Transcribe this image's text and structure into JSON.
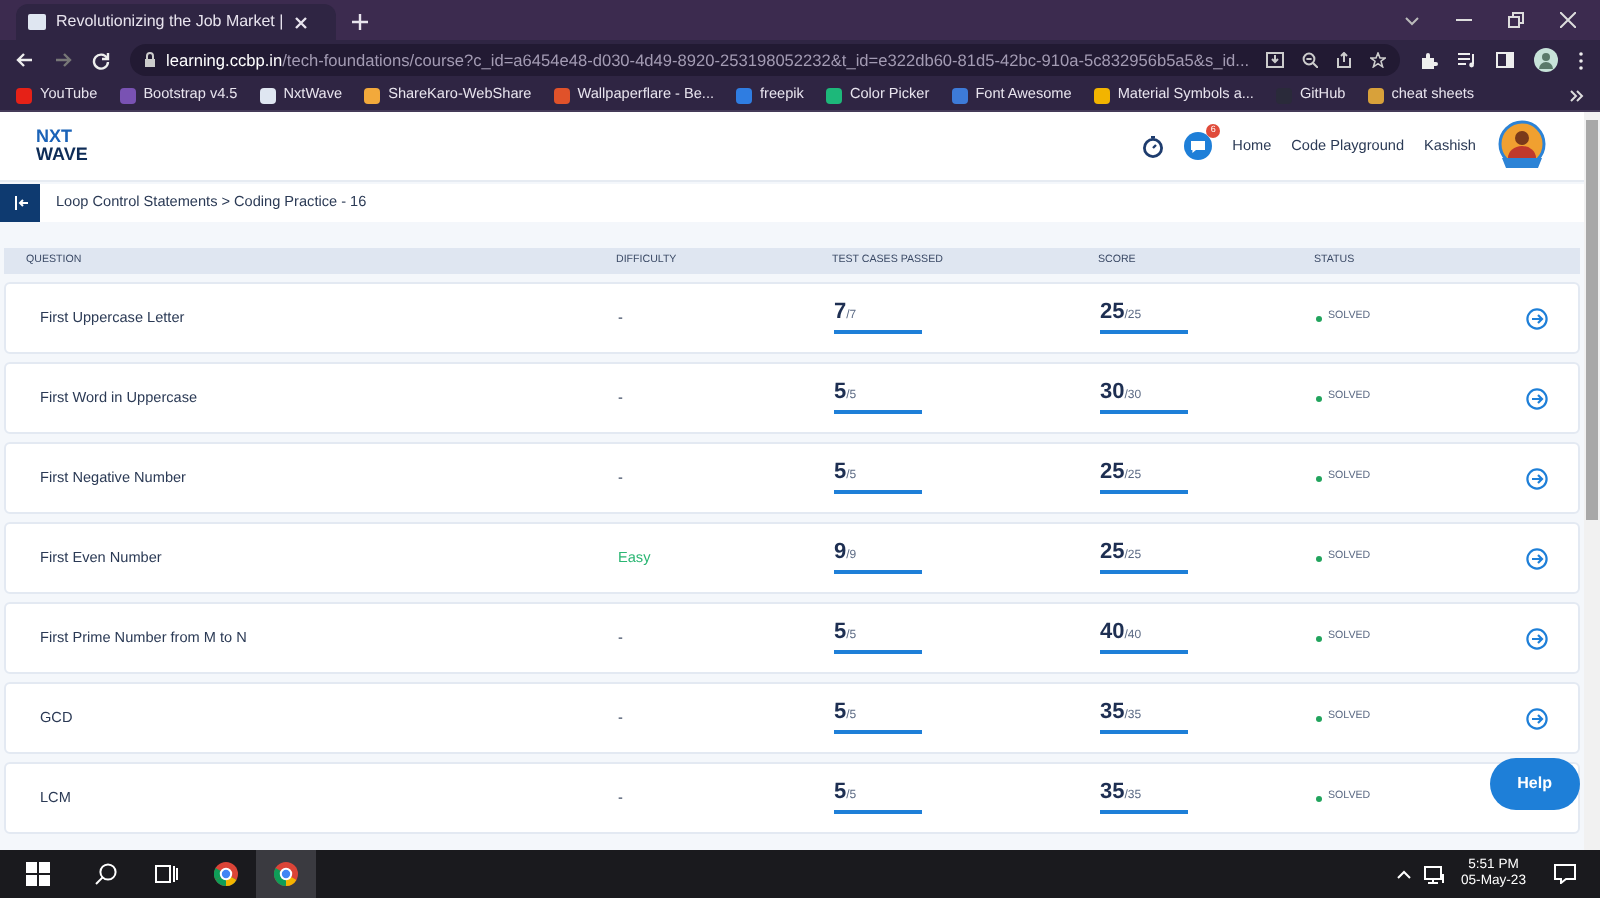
{
  "browser": {
    "tab_title": "Revolutionizing the Job Market |",
    "url_host": "learning.ccbp.in",
    "url_path": "/tech-foundations/course?c_id=a6454e48-d030-4d49-8920-253198052232&t_id=e322db60-81d5-42bc-910a-5c832956b5a5&s_id...",
    "bookmarks": [
      {
        "label": "YouTube",
        "color": "#e62117"
      },
      {
        "label": "Bootstrap v4.5",
        "color": "#7952b3"
      },
      {
        "label": "NxtWave",
        "color": "#dfe6f1"
      },
      {
        "label": "ShareKaro-WebShare",
        "color": "#f2a93b"
      },
      {
        "label": "Wallpaperflare - Be...",
        "color": "#e0522a"
      },
      {
        "label": "freepik",
        "color": "#2f7de1"
      },
      {
        "label": "Color Picker",
        "color": "#1db87a"
      },
      {
        "label": "Font Awesome",
        "color": "#3d7bd8"
      },
      {
        "label": "Material Symbols a...",
        "color": "#f2b400"
      },
      {
        "label": "GitHub",
        "color": "#2a2a3a"
      },
      {
        "label": "cheat sheets",
        "color": "#d8a13a"
      }
    ]
  },
  "header": {
    "logo_top": "NXT",
    "logo_bottom": "WAVE",
    "notification_count": "6",
    "nav": [
      "Home",
      "Code Playground"
    ],
    "user": "Kashish"
  },
  "breadcrumb": "Loop Control Statements > Coding Practice - 16",
  "table": {
    "columns": [
      "QUESTION",
      "DIFFICULTY",
      "TEST CASES PASSED",
      "SCORE",
      "STATUS"
    ],
    "rows": [
      {
        "question": "First Uppercase Letter",
        "difficulty": "-",
        "passed": "7",
        "total": "/7",
        "passed_bar": {
          "level": 1
        },
        "score": "25",
        "max": "/25",
        "score_bar": {
          "level": 1
        },
        "status": "SOLVED"
      },
      {
        "question": "First Word in Uppercase",
        "difficulty": "-",
        "passed": "5",
        "total": "/5",
        "passed_bar": {
          "level": 1
        },
        "score": "30",
        "max": "/30",
        "score_bar": {
          "level": 1
        },
        "status": "SOLVED"
      },
      {
        "question": "First Negative Number",
        "difficulty": "-",
        "passed": "5",
        "total": "/5",
        "passed_bar": {
          "level": 1
        },
        "score": "25",
        "max": "/25",
        "score_bar": {
          "level": 1
        },
        "status": "SOLVED"
      },
      {
        "question": "First Even Number",
        "difficulty": "Easy",
        "passed": "9",
        "total": "/9",
        "passed_bar": {
          "level": 1
        },
        "score": "25",
        "max": "/25",
        "score_bar": {
          "level": 1
        },
        "status": "SOLVED"
      },
      {
        "question": "First Prime Number from M to N",
        "difficulty": "-",
        "passed": "5",
        "total": "/5",
        "passed_bar": {
          "level": 1
        },
        "score": "40",
        "max": "/40",
        "score_bar": {
          "level": 1
        },
        "status": "SOLVED"
      },
      {
        "question": "GCD",
        "difficulty": "-",
        "passed": "5",
        "total": "/5",
        "passed_bar": {
          "level": 1
        },
        "score": "35",
        "max": "/35",
        "score_bar": {
          "level": 1
        },
        "status": "SOLVED"
      },
      {
        "question": "LCM",
        "difficulty": "-",
        "passed": "5",
        "total": "/5",
        "passed_bar": {
          "level": 1
        },
        "score": "35",
        "max": "/35",
        "score_bar": {
          "level": 1
        },
        "status": "SOLVED"
      }
    ]
  },
  "help_button": "Help",
  "taskbar": {
    "time": "5:51 PM",
    "date": "05-May-23"
  }
}
